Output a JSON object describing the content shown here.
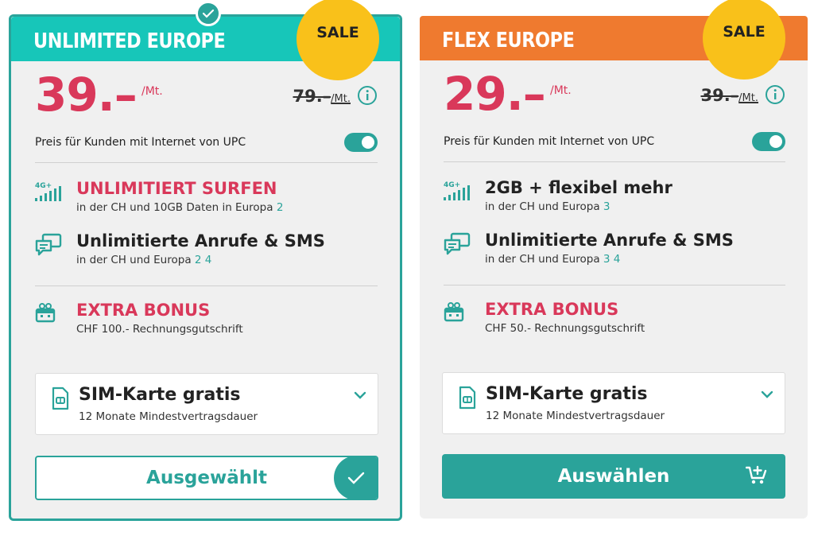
{
  "plans": [
    {
      "title": "UNLIMITED EUROPE",
      "sale": "SALE",
      "price": "39.–",
      "price_unit": "/Mt.",
      "old_price": "79.–",
      "old_unit": "/Mt.",
      "upc_label": "Preis für Kunden mit Internet von UPC",
      "data_title": "UNLIMITIERT SURFEN",
      "data_sub": "in der CH und 10GB Daten in Europa",
      "data_ref": "2",
      "calls_title": "Unlimitierte Anrufe & SMS",
      "calls_sub": "in der CH und Europa",
      "calls_ref": "2 4",
      "bonus_title": "EXTRA BONUS",
      "bonus_sub": "CHF 100.- Rechnungsgutschrift",
      "sim_title": "SIM-Karte gratis",
      "sim_sub": "12 Monate Mindestvertragsdauer",
      "button": "Ausgewählt"
    },
    {
      "title": "FLEX EUROPE",
      "sale": "SALE",
      "price": "29.–",
      "price_unit": "/Mt.",
      "old_price": "39.–",
      "old_unit": "/Mt.",
      "upc_label": "Preis für Kunden mit Internet von UPC",
      "data_title": "2GB + flexibel mehr",
      "data_sub": "in der CH und Europa",
      "data_ref": "3",
      "calls_title": "Unlimitierte Anrufe & SMS",
      "calls_sub": "in der CH und Europa",
      "calls_ref": "3 4",
      "bonus_title": "EXTRA BONUS",
      "bonus_sub": "CHF 50.- Rechnungsgutschrift",
      "sim_title": "SIM-Karte gratis",
      "sim_sub": "12 Monate Mindestvertragsdauer",
      "button": "Auswählen"
    }
  ],
  "network_badge": "4G+",
  "colors": {
    "teal": "#2aa39a",
    "teal_header": "#17c6b9",
    "orange_header": "#ef7a2f",
    "sale_yellow": "#f9c11a",
    "price_red": "#d9385a"
  },
  "icons": [
    "check-icon",
    "info-icon",
    "signal-4g-icon",
    "chat-icon",
    "gift-icon",
    "sim-card-icon",
    "chevron-down-icon",
    "cart-add-icon"
  ]
}
